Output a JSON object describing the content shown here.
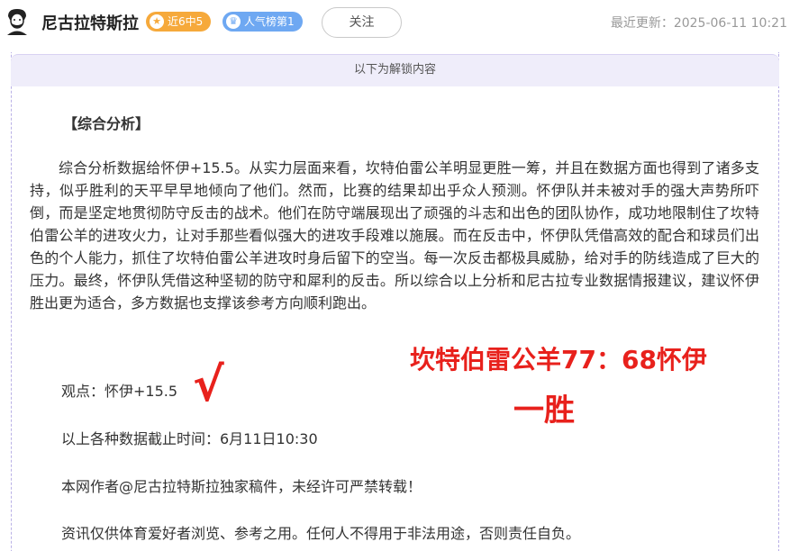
{
  "header": {
    "author_name": "尼古拉特斯拉",
    "badge_recent": "近6中5",
    "badge_recent_icon": "star-icon",
    "badge_popular": "人气榜第1",
    "badge_popular_icon": "crown-icon",
    "follow_label": "关注",
    "last_updated": "最近更新：2025-06-11 10:21"
  },
  "locked_section": {
    "unlock_label": "以下为解锁内容"
  },
  "article": {
    "section_title": "【综合分析】",
    "analysis_text": "综合分析数据给怀伊+15.5。从实力层面来看，坎特伯雷公羊明显更胜一筹，并且在数据方面也得到了诸多支持，似乎胜利的天平早早地倾向了他们。然而，比赛的结果却出乎众人预测。怀伊队并未被对手的强大声势所吓倒，而是坚定地贯彻防守反击的战术。他们在防守端展现出了顽强的斗志和出色的团队协作，成功地限制住了坎特伯雷公羊的进攻火力，让对手那些看似强大的进攻手段难以施展。而在反击中，怀伊队凭借高效的配合和球员们出色的个人能力，抓住了坎特伯雷公羊进攻时身后留下的空当。每一次反击都极具威胁，给对手的防线造成了巨大的压力。最终，怀伊队凭借这种坚韧的防守和犀利的反击。所以综合以上分析和尼古拉专业数据情报建议，建议怀伊胜出更为适合，多方数据也支撑该参考方向顺利跑出。",
    "viewpoint": "观点：怀伊+15.5",
    "check_mark": "√",
    "score_line": "坎特伯雷公羊77：68怀伊",
    "result_text": "一胜",
    "cutoff_time": "以上各种数据截止时间：6月11日10:30",
    "copyright": "本网作者@尼古拉特斯拉独家稿件，未经许可严禁转载！",
    "disclaimer": "资讯仅供体育爱好者浏览、参考之用。任何人不得用于非法用途，否则责任自负。"
  },
  "colors": {
    "accent_red": "#e8211c",
    "badge_orange": "#f6a93b",
    "badge_blue": "#6ea8f2",
    "unlock_bar_bg": "#efedfa"
  }
}
